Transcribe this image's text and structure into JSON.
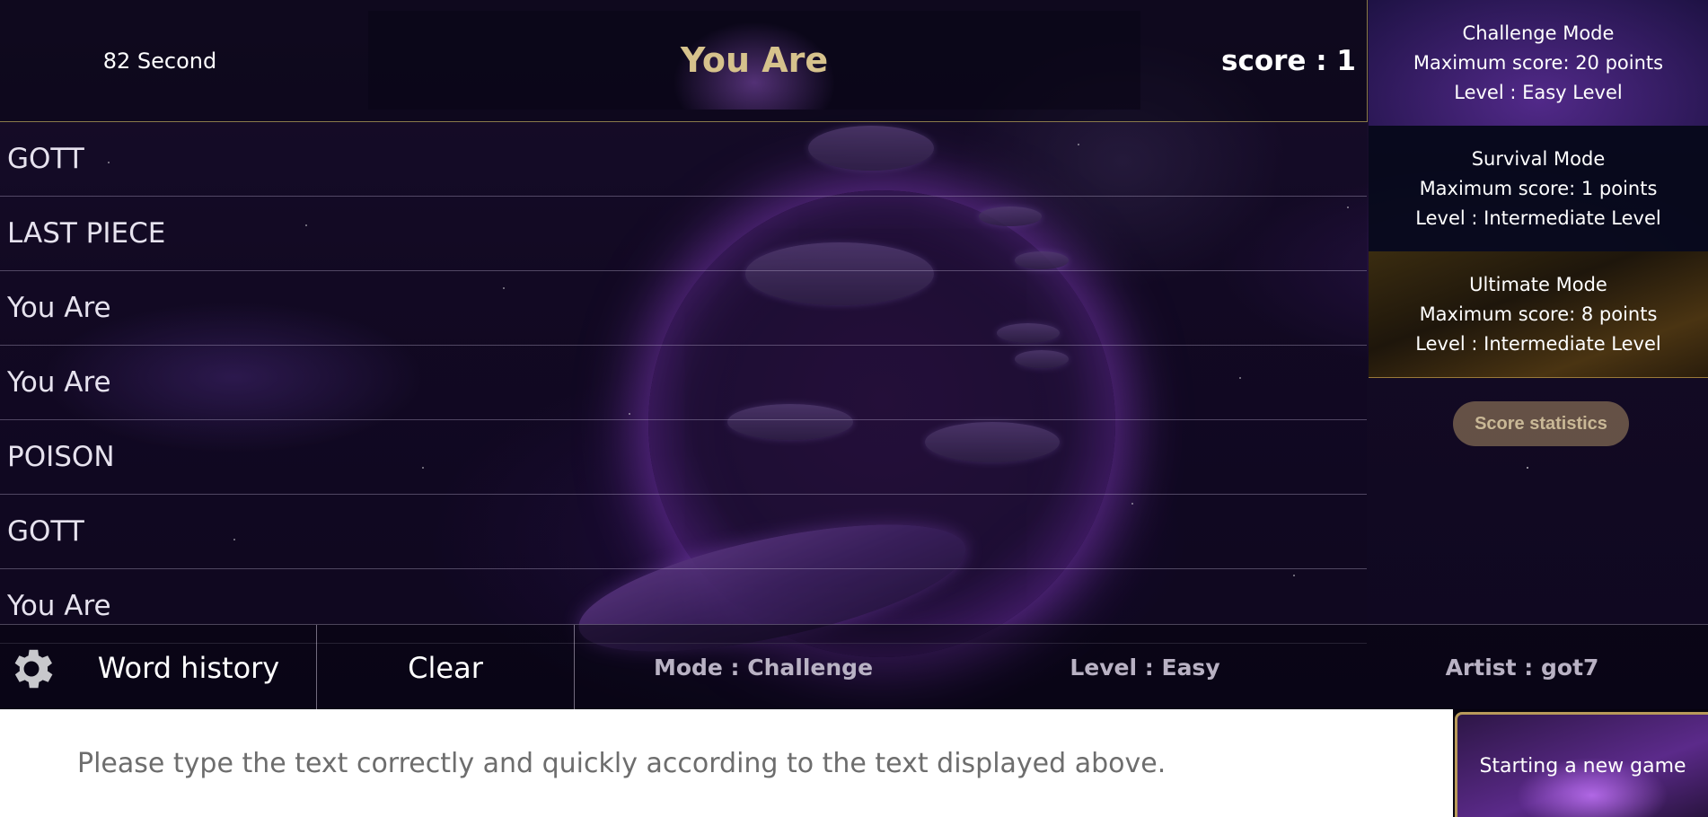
{
  "header": {
    "timer": "82 Second",
    "current_word": "You Are",
    "score": "score : 1"
  },
  "word_rows": [
    "GOTT",
    "LAST PIECE",
    "You Are",
    "You Are",
    "POISON",
    "GOTT",
    "You Are"
  ],
  "modes": [
    {
      "name": "Challenge Mode",
      "max_score": "Maximum score: 20 points",
      "level": "Level : Easy Level"
    },
    {
      "name": "Survival Mode",
      "max_score": "Maximum score: 1 points",
      "level": "Level : Intermediate Level"
    },
    {
      "name": "Ultimate Mode",
      "max_score": "Maximum score: 8 points",
      "level": "Level : Intermediate Level"
    }
  ],
  "score_statistics_label": "Score statistics",
  "bottom_bar": {
    "settings_icon": "gear-icon",
    "word_history_label": "Word history",
    "clear_label": "Clear",
    "mode_info": "Mode : Challenge",
    "level_info": "Level : Easy",
    "artist_info": "Artist : got7"
  },
  "input": {
    "placeholder": "Please type the text correctly and quickly according to the text displayed above.",
    "value": ""
  },
  "new_game_label": "Starting a new game",
  "colors": {
    "word_gold": "#d6c28c",
    "accent_gold": "#b89a5a",
    "planet_purple": "#8e3fe0"
  }
}
